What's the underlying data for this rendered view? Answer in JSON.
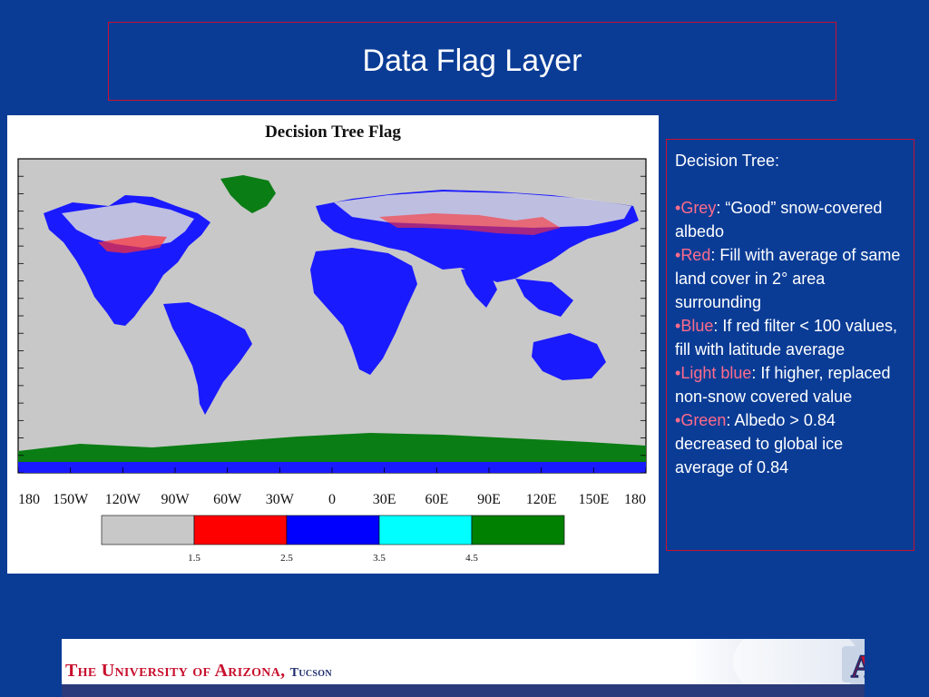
{
  "slide": {
    "title": "Data Flag Layer"
  },
  "figure": {
    "title": "Decision Tree Flag",
    "x_ticks": [
      "180",
      "150W",
      "120W",
      "90W",
      "60W",
      "30W",
      "0",
      "30E",
      "60E",
      "90E",
      "120E",
      "150E",
      "180"
    ],
    "colorbar": {
      "colors": [
        "#c8c8c8",
        "#ff0000",
        "#0000ff",
        "#00ffff",
        "#008000"
      ],
      "labels": [
        "1.5",
        "2.5",
        "3.5",
        "4.5"
      ]
    }
  },
  "textbox": {
    "heading": "Decision Tree:",
    "items": [
      {
        "keyword": "Grey",
        "text": ": “Good” snow-covered albedo"
      },
      {
        "keyword": "Red",
        "text": ": Fill with average of same land cover in 2° area surrounding"
      },
      {
        "keyword": "Blue",
        "text": ": If red filter < 100 values, fill with latitude average"
      },
      {
        "keyword": "Light blue",
        "text": ": If higher, replaced non-snow covered value"
      },
      {
        "keyword": "Green",
        "text": ": Albedo > 0.84 decreased to global ice average of 0.84"
      }
    ],
    "bullet": "•"
  },
  "footer": {
    "university": "The University of Arizona,",
    "city": "Tucson",
    "logo_letter": "A"
  },
  "colors": {
    "background": "#0a3c96",
    "accent_red": "#c8102e",
    "keyword": "#ff6b8a"
  }
}
